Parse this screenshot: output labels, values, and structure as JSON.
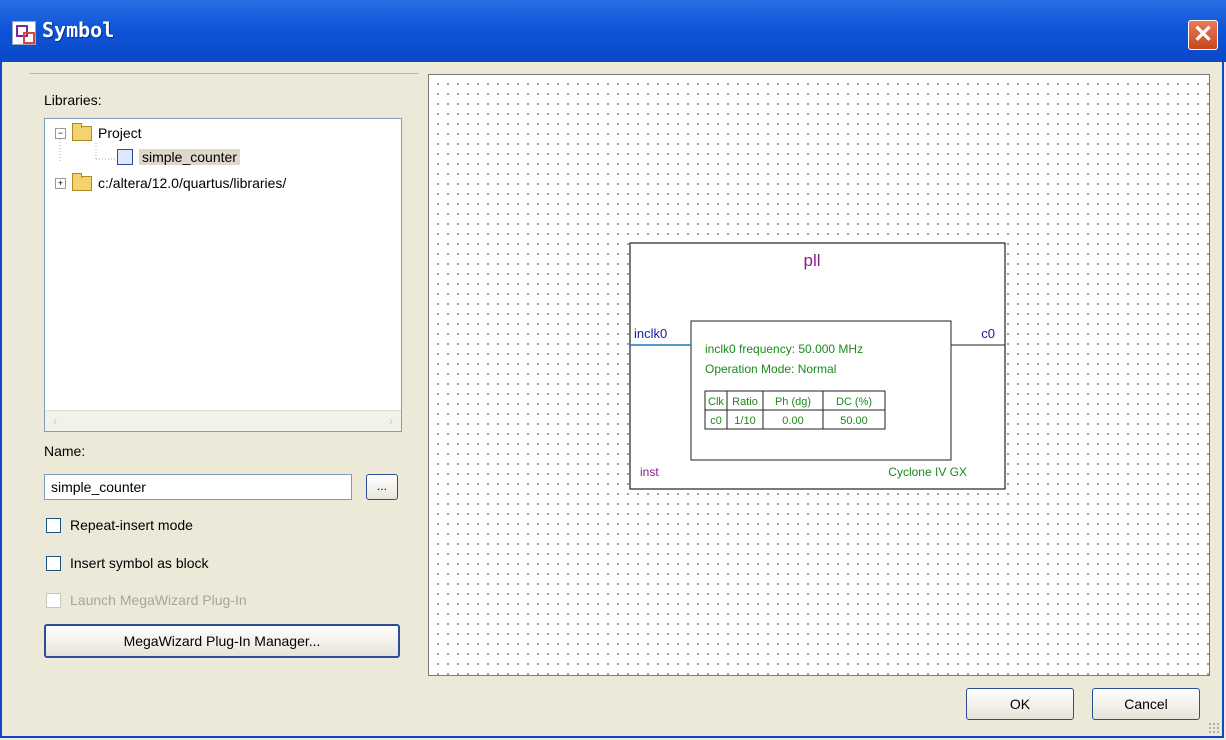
{
  "window": {
    "title": "Symbol",
    "close_glyph": "✕"
  },
  "libraries": {
    "label": "Libraries:",
    "items": [
      {
        "label": "Project",
        "expander": "−"
      },
      {
        "label": "simple_counter"
      },
      {
        "label": "c:/altera/12.0/quartus/libraries/",
        "expander": "+"
      }
    ]
  },
  "name": {
    "label": "Name:",
    "value": "simple_counter",
    "browse_label": "..."
  },
  "options": {
    "repeat_insert": "Repeat-insert mode",
    "insert_as_block": "Insert symbol as block",
    "launch_megawizard": "Launch MegaWizard Plug-In"
  },
  "megawizard_button": "MegaWizard Plug-In Manager...",
  "symbol": {
    "name": "pll",
    "input_port": "inclk0",
    "output_port": "c0",
    "instance": "inst",
    "device": "Cyclone IV GX",
    "info_frequency": "inclk0 frequency: 50.000 MHz",
    "info_mode": "Operation Mode: Normal",
    "table": {
      "headers": [
        "Clk",
        "Ratio",
        "Ph (dg)",
        "DC (%)"
      ],
      "rows": [
        [
          "c0",
          "1/10",
          "0.00",
          "50.00"
        ]
      ]
    }
  },
  "buttons": {
    "ok": "OK",
    "cancel": "Cancel"
  },
  "colors": {
    "symbol_name": "#8b1a8b",
    "ports": "#1a1aa0",
    "info_text": "#1a8a1a",
    "port_line": "#1a7ab0"
  }
}
